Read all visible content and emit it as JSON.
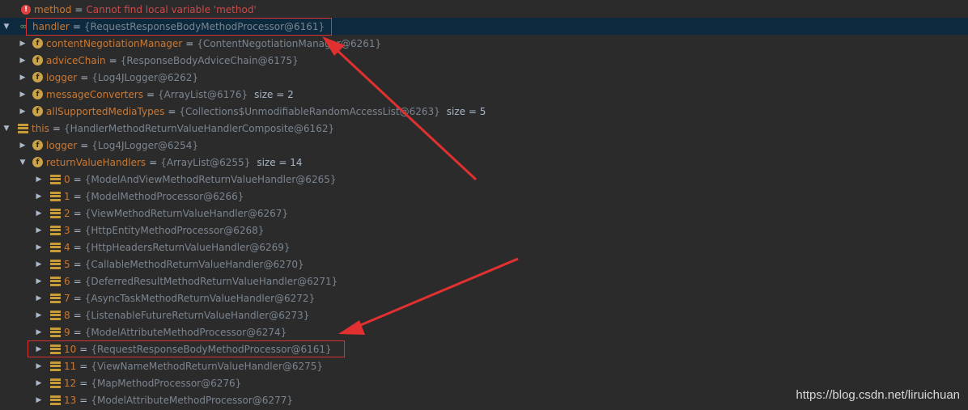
{
  "rows": [
    {
      "name": "method",
      "eq": "=",
      "value": "Cannot find local variable 'method'",
      "kind": "error"
    },
    {
      "name": "handler",
      "eq": "=",
      "value": "{RequestResponseBodyMethodProcessor@6161}",
      "kind": "watch"
    },
    {
      "name": "contentNegotiationManager",
      "eq": "=",
      "value": "{ContentNegotiationManager@6261}",
      "kind": "field"
    },
    {
      "name": "adviceChain",
      "eq": "=",
      "value": "{ResponseBodyAdviceChain@6175}",
      "kind": "field"
    },
    {
      "name": "logger",
      "eq": "=",
      "value": "{Log4JLogger@6262}",
      "kind": "field"
    },
    {
      "name": "messageConverters",
      "eq": "=",
      "value": "{ArrayList@6176}",
      "size": "size = 2",
      "kind": "field"
    },
    {
      "name": "allSupportedMediaTypes",
      "eq": "=",
      "value": "{Collections$UnmodifiableRandomAccessList@6263}",
      "size": "size = 5",
      "kind": "field"
    },
    {
      "name": "this",
      "eq": "=",
      "value": "{HandlerMethodReturnValueHandlerComposite@6162}",
      "kind": "list"
    },
    {
      "name": "logger",
      "eq": "=",
      "value": "{Log4JLogger@6254}",
      "kind": "field"
    },
    {
      "name": "returnValueHandlers",
      "eq": "=",
      "value": "{ArrayList@6255}",
      "size": "size = 14",
      "kind": "field"
    },
    {
      "name": "0",
      "eq": "=",
      "value": "{ModelAndViewMethodReturnValueHandler@6265}",
      "kind": "list"
    },
    {
      "name": "1",
      "eq": "=",
      "value": "{ModelMethodProcessor@6266}",
      "kind": "list"
    },
    {
      "name": "2",
      "eq": "=",
      "value": "{ViewMethodReturnValueHandler@6267}",
      "kind": "list"
    },
    {
      "name": "3",
      "eq": "=",
      "value": "{HttpEntityMethodProcessor@6268}",
      "kind": "list"
    },
    {
      "name": "4",
      "eq": "=",
      "value": "{HttpHeadersReturnValueHandler@6269}",
      "kind": "list"
    },
    {
      "name": "5",
      "eq": "=",
      "value": "{CallableMethodReturnValueHandler@6270}",
      "kind": "list"
    },
    {
      "name": "6",
      "eq": "=",
      "value": "{DeferredResultMethodReturnValueHandler@6271}",
      "kind": "list"
    },
    {
      "name": "7",
      "eq": "=",
      "value": "{AsyncTaskMethodReturnValueHandler@6272}",
      "kind": "list"
    },
    {
      "name": "8",
      "eq": "=",
      "value": "{ListenableFutureReturnValueHandler@6273}",
      "kind": "list"
    },
    {
      "name": "9",
      "eq": "=",
      "value": "{ModelAttributeMethodProcessor@6274}",
      "kind": "list"
    },
    {
      "name": "10",
      "eq": "=",
      "value": "{RequestResponseBodyMethodProcessor@6161}",
      "kind": "list"
    },
    {
      "name": "11",
      "eq": "=",
      "value": "{ViewNameMethodReturnValueHandler@6275}",
      "kind": "list"
    },
    {
      "name": "12",
      "eq": "=",
      "value": "{MapMethodProcessor@6276}",
      "kind": "list"
    },
    {
      "name": "13",
      "eq": "=",
      "value": "{ModelAttributeMethodProcessor@6277}",
      "kind": "list"
    }
  ],
  "watermark": "https://blog.csdn.net/liruichuan",
  "colors": {
    "background": "#2b2b2b",
    "selected": "#0d293e",
    "highlight": "#d93030",
    "name": "#cb7832",
    "value": "#7b8590"
  },
  "icons": {
    "error": "error-icon",
    "watch": "watch-icon",
    "field": "field-icon",
    "list": "list-icon",
    "expand": "triangle-icon"
  }
}
